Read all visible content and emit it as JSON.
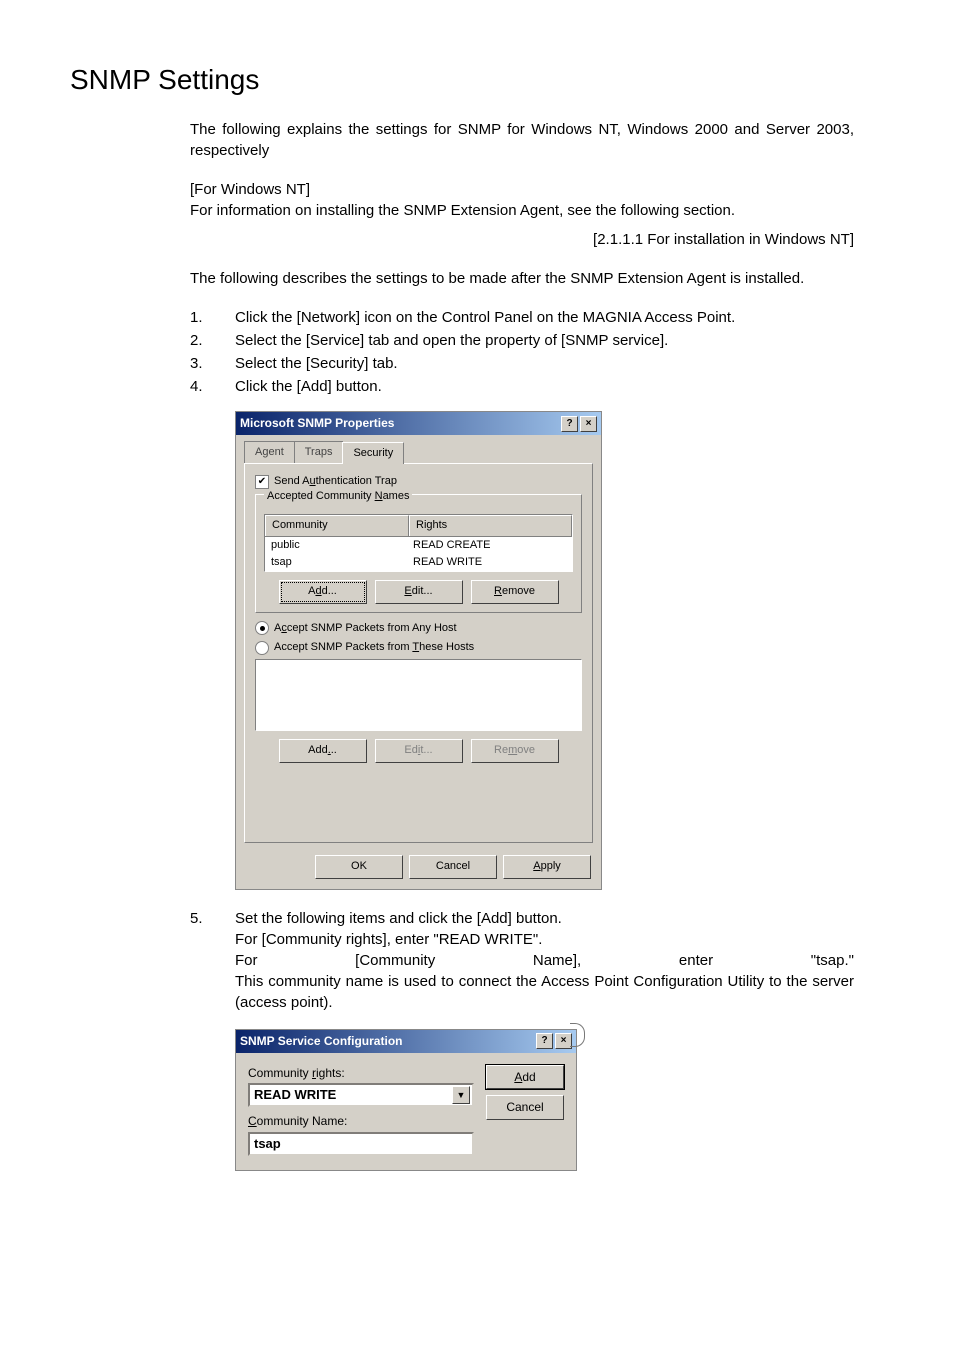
{
  "heading": "SNMP Settings",
  "intro": "The following explains the settings for SNMP for Windows NT, Windows 2000 and Server 2003, respectively",
  "nt_label": "[For Windows NT]",
  "nt_info": "For information on installing the SNMP Extension Agent, see the following section.",
  "xref": "[2.1.1.1  For installation in Windows NT]",
  "after_install": "The following describes the settings to be made after the SNMP Extension Agent is installed.",
  "steps_a": [
    "Click the [Network] icon on the Control Panel on the MAGNIA Access Point.",
    "Select the [Service] tab and open the property of [SNMP service].",
    "Select the [Security] tab.",
    "Click the [Add] button."
  ],
  "dlg1": {
    "title": "Microsoft SNMP Properties",
    "tabs": [
      "Agent",
      "Traps",
      "Security"
    ],
    "active_tab": 2,
    "chk_label_pre": "Send A",
    "chk_label_u": "u",
    "chk_label_post": "thentication Trap",
    "group_label_pre": "Accepted Community ",
    "group_label_u": "N",
    "group_label_post": "ames",
    "cols": [
      "Community",
      "Rights"
    ],
    "rows": [
      [
        "public",
        "READ CREATE"
      ],
      [
        "tsap",
        "READ WRITE"
      ]
    ],
    "buttons": {
      "add": "Add...",
      "edit": "Edit...",
      "remove": "Remove"
    },
    "radio1": {
      "pre": "A",
      "u": "c",
      "post": "cept SNMP Packets from Any Host"
    },
    "radio2": {
      "pre": "Accept SNMP Packets from ",
      "u": "T",
      "post": "hese Hosts"
    },
    "buttons2": {
      "add": "Add...",
      "edit": "Edit...",
      "remove": "Remove"
    },
    "ok": "OK",
    "cancel": "Cancel",
    "apply": "Apply"
  },
  "step5_num": "5.",
  "step5_lines": [
    "Set the following items and click the [Add] button.",
    "For [Community rights], enter \"READ WRITE\"."
  ],
  "step5_justify": [
    "For",
    "[Community",
    "Name],",
    "enter",
    "\"tsap.\""
  ],
  "step5_tail": "This community name is used to connect the Access Point Configuration Utility to the server (access point).",
  "dlg2": {
    "title": "SNMP Service Configuration",
    "community_rights_label": {
      "pre": "Community ",
      "u": "r",
      "post": "ights:"
    },
    "community_rights_value": "READ WRITE",
    "community_name_label": {
      "u": "C",
      "post": "ommunity Name:"
    },
    "community_name_value": "tsap",
    "add_btn": {
      "u": "A",
      "post": "dd"
    },
    "cancel_btn": "Cancel"
  }
}
